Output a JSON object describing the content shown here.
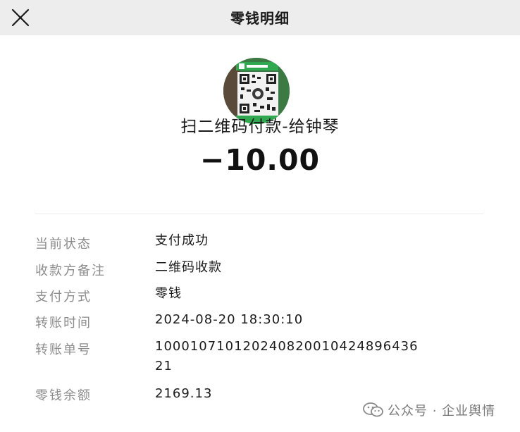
{
  "header": {
    "title": "零钱明细"
  },
  "transaction": {
    "payee": "扫二维码付款-给钟琴",
    "amount": "−10.00"
  },
  "details": {
    "status_label": "当前状态",
    "status_value": "支付成功",
    "note_label": "收款方备注",
    "note_value": "二维码收款",
    "method_label": "支付方式",
    "method_value": "零钱",
    "time_label": "转账时间",
    "time_value": "2024-08-20 18:30:10",
    "order_label": "转账单号",
    "order_value": "100010710120240820010424896436\n21",
    "balance_label": "零钱余额",
    "balance_value": "2169.13"
  },
  "watermark": {
    "text": "公众号 · 企业舆情"
  },
  "colors": {
    "topbar": "#ededed",
    "avatar_bg": "#2e7d3a",
    "label": "#8c8c8c"
  },
  "icons": {
    "close": "close-icon",
    "watermark": "wechat-logo-icon"
  }
}
